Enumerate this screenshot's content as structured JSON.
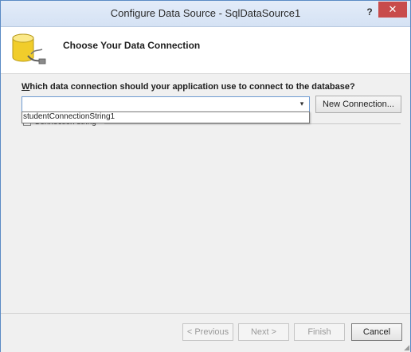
{
  "window": {
    "title": "Configure Data Source - SqlDataSource1",
    "help_label": "?",
    "close_label": "✕"
  },
  "header": {
    "title": "Choose Your Data Connection",
    "icon": "database-icon"
  },
  "connection": {
    "question_accel": "W",
    "question_rest": "hich data connection should your application use to connect to the database?",
    "selected_value": "",
    "options": [
      "studentConnectionString1"
    ],
    "new_connection_button": "New Connection..."
  },
  "connection_string": {
    "label": "Connection string",
    "expander": "+"
  },
  "footer": {
    "previous": "< Previous",
    "next": "Next >",
    "finish": "Finish",
    "cancel": "Cancel"
  },
  "colors": {
    "title_bar": "#d5e2f4",
    "close_button": "#c84b4b",
    "combo_border": "#6f9bd1"
  }
}
